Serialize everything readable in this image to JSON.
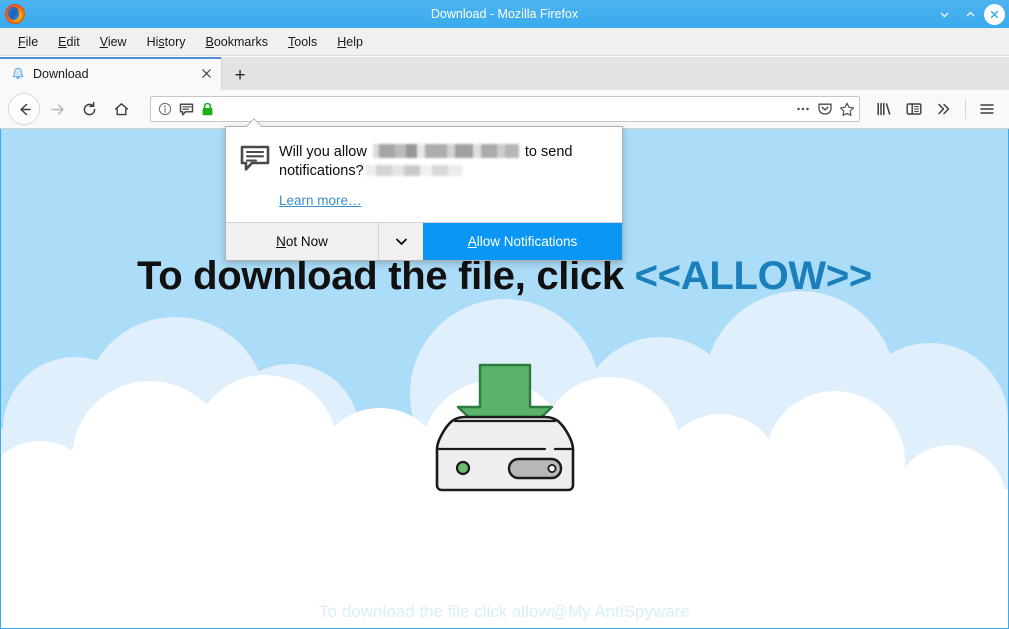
{
  "window": {
    "title": "Download - Mozilla Firefox",
    "logo_icon": "firefox-logo",
    "minimize_label": "⌄",
    "maximize_label": "⌃",
    "close_label": "×"
  },
  "menubar": {
    "items": [
      {
        "label": "File",
        "mnemonic": "F"
      },
      {
        "label": "Edit",
        "mnemonic": "E"
      },
      {
        "label": "View",
        "mnemonic": "V"
      },
      {
        "label": "History",
        "mnemonic": "s"
      },
      {
        "label": "Bookmarks",
        "mnemonic": "B"
      },
      {
        "label": "Tools",
        "mnemonic": "T"
      },
      {
        "label": "Help",
        "mnemonic": "H"
      }
    ]
  },
  "tabbar": {
    "tabs": [
      {
        "title": "Download",
        "favicon": "bell-favicon",
        "close_label": "×",
        "active": true
      }
    ],
    "new_tab_label": "+"
  },
  "navbar": {
    "back_icon": "back-arrow-icon",
    "forward_icon": "forward-arrow-icon",
    "reload_icon": "reload-icon",
    "home_icon": "home-icon",
    "urlbar": {
      "value": "",
      "placeholder": "",
      "identity_icons": [
        "info-icon",
        "notification-bubble-icon",
        "green-padlock-icon"
      ]
    },
    "urlbar_actions": [
      "page-actions-ellipsis-icon",
      "pocket-icon",
      "bookmark-star-icon"
    ],
    "toolbar_icons": [
      "library-icon",
      "sidebar-icon",
      "overflow-chevrons-icon",
      "hamburger-menu-icon"
    ]
  },
  "popup": {
    "icon": "notification-bubble-icon",
    "question_before": "Will you allow",
    "question_after": "to send",
    "question_line2": "notifications?",
    "host_redacted": true,
    "learn_more": "Learn more…",
    "buttons": {
      "not_now": "Not Now",
      "not_now_mnemonic": "N",
      "dropdown_icon": "chevron-down-icon",
      "allow": "Allow Notifications",
      "allow_mnemonic": "A"
    }
  },
  "page": {
    "headline_prefix": "To download the file, click ",
    "headline_allow": "<<ALLOW>>",
    "illustration": "download-arrow-into-drive",
    "watermark": "To download the file click allow@My AntiSpyware"
  },
  "colors": {
    "sky": "#abdcf8",
    "cloud_back": "#dff0fc",
    "cloud_front": "#ffffff",
    "titlebar": "#3aabec",
    "accent_blue": "#0a96f5",
    "allow_text_blue": "#1a7fba",
    "arrow_green": "#5bb36a",
    "drive_body": "#eeeeee"
  }
}
